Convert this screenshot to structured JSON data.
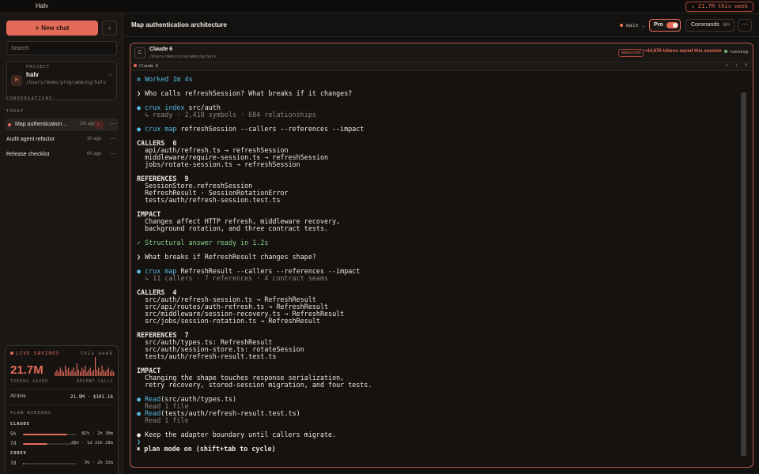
{
  "titlebar": {
    "app_name": "Halv",
    "week_pill": "↓ 21.7M this week"
  },
  "sidebar": {
    "new_chat_label": "New chat",
    "collapse_icon": "‹",
    "search_placeholder": "Search",
    "project": {
      "label": "PROJECT",
      "avatar": "H",
      "name": "halv",
      "path": "/Users/demo/programming/halv"
    },
    "conversations_label": "CONVERSATIONS",
    "today_label": "TODAY",
    "conversations": [
      {
        "title": "Map authentication…",
        "time": "2m ago"
      },
      {
        "title": "Audit agent refactor",
        "time": "2h ago"
      },
      {
        "title": "Release checklist",
        "time": "6h ago"
      }
    ],
    "savings": {
      "live_label": "LIVE SAVINGS",
      "week_label": "this week",
      "tokens_saved": "21.7M",
      "tokens_saved_label": "TOKENS SAVED",
      "recent_calls_label": "RECENT CALLS",
      "recent_calls": [
        2,
        3,
        2,
        4,
        3,
        2,
        5,
        3,
        4,
        2,
        3,
        4,
        2,
        6,
        3,
        2,
        4,
        3,
        5,
        2,
        3,
        4,
        2,
        3,
        9,
        3,
        4,
        2,
        5,
        3,
        2,
        3,
        4,
        2,
        3,
        2
      ],
      "all_time_label": "All time",
      "all_time_value": "21.9M · $101.16",
      "plan_windows_label": "PLAN WINDOWS",
      "groups": [
        {
          "name": "CLAUDE",
          "rows": [
            {
              "label": "5h",
              "fraction": 0.82,
              "value": "82% · 2h 38m"
            },
            {
              "label": "7d",
              "fraction": 0.45,
              "value": "45% · 1d 21h 28m"
            }
          ]
        },
        {
          "name": "CODEX",
          "rows": [
            {
              "label": "7d",
              "fraction": 0.03,
              "value": "3% · 2h 32m"
            }
          ]
        }
      ]
    }
  },
  "main": {
    "title": "Map authentication architecture",
    "branch": "main",
    "pro_label": "Pro",
    "pro_enabled": true,
    "commands_label": "Commands",
    "commands_kbd": "⌘K",
    "more_icon": "···"
  },
  "session": {
    "avatar": "C",
    "name": "Claude 6",
    "path": "/Users/demo/programming/halv",
    "measured_label": "measured",
    "tokens_saved": "≈44,876 tokens saved this session",
    "status": "running",
    "tab_label": "Claude 6",
    "window_controls": [
      "⌐",
      "↓",
      "×"
    ]
  },
  "terminal": {
    "lines": [
      {
        "kind": "accent",
        "text": "✻ Worked 1m 4s"
      },
      {
        "kind": "blank",
        "text": ""
      },
      {
        "kind": "prompt",
        "text": "❯ Who calls refreshSession? What breaks if it changes?"
      },
      {
        "kind": "blank",
        "text": ""
      },
      {
        "kind": "tool",
        "cmd": "crux index",
        "arg": " src/auth"
      },
      {
        "kind": "dim",
        "text": "  ↳ ready · 2,418 symbols · 684 relationships"
      },
      {
        "kind": "blank",
        "text": ""
      },
      {
        "kind": "tool",
        "cmd": "crux map",
        "arg": " refreshSession --callers --references --impact"
      },
      {
        "kind": "blank",
        "text": ""
      },
      {
        "kind": "heading",
        "text": "CALLERS  6"
      },
      {
        "kind": "text",
        "text": "  api/auth/refresh.ts → refreshSession"
      },
      {
        "kind": "text",
        "text": "  middleware/require-session.ts → refreshSession"
      },
      {
        "kind": "text",
        "text": "  jobs/rotate-session.ts → refreshSession"
      },
      {
        "kind": "blank",
        "text": ""
      },
      {
        "kind": "heading",
        "text": "REFERENCES  9"
      },
      {
        "kind": "text",
        "text": "  SessionStore.refreshSession"
      },
      {
        "kind": "text",
        "text": "  RefreshResult · SessionRotationError"
      },
      {
        "kind": "text",
        "text": "  tests/auth/refresh-session.test.ts"
      },
      {
        "kind": "blank",
        "text": ""
      },
      {
        "kind": "heading",
        "text": "IMPACT"
      },
      {
        "kind": "text",
        "text": "  Changes affect HTTP refresh, middleware recovery,"
      },
      {
        "kind": "text",
        "text": "  background rotation, and three contract tests."
      },
      {
        "kind": "blank",
        "text": ""
      },
      {
        "kind": "success",
        "text": "✓ Structural answer ready in 1.2s"
      },
      {
        "kind": "blank",
        "text": ""
      },
      {
        "kind": "prompt",
        "text": "❯ What breaks if RefreshResult changes shape?"
      },
      {
        "kind": "blank",
        "text": ""
      },
      {
        "kind": "tool",
        "cmd": "crux map",
        "arg": " RefreshResult --callers --references --impact"
      },
      {
        "kind": "dim",
        "text": "  ↳ 11 callers · 7 references · 4 contract seams"
      },
      {
        "kind": "blank",
        "text": ""
      },
      {
        "kind": "heading",
        "text": "CALLERS  4"
      },
      {
        "kind": "text",
        "text": "  src/auth/refresh-session.ts → RefreshResult"
      },
      {
        "kind": "text",
        "text": "  src/api/routes/auth-refresh.ts → RefreshResult"
      },
      {
        "kind": "text",
        "text": "  src/middleware/session-recovery.ts → RefreshResult"
      },
      {
        "kind": "text",
        "text": "  src/jobs/session-rotation.ts → RefreshResult"
      },
      {
        "kind": "blank",
        "text": ""
      },
      {
        "kind": "heading",
        "text": "REFERENCES  7"
      },
      {
        "kind": "text",
        "text": "  src/auth/types.ts: RefreshResult"
      },
      {
        "kind": "text",
        "text": "  src/auth/session-store.ts: rotateSession"
      },
      {
        "kind": "text",
        "text": "  tests/auth/refresh-result.test.ts"
      },
      {
        "kind": "blank",
        "text": ""
      },
      {
        "kind": "heading",
        "text": "IMPACT"
      },
      {
        "kind": "text",
        "text": "  Changing the shape touches response serialization,"
      },
      {
        "kind": "text",
        "text": "  retry recovery, stored-session migration, and four tests."
      },
      {
        "kind": "blank",
        "text": ""
      },
      {
        "kind": "read",
        "cmd": "Read",
        "arg": "(src/auth/types.ts)"
      },
      {
        "kind": "dim",
        "text": "  Read 1 file"
      },
      {
        "kind": "read",
        "cmd": "Read",
        "arg": "(tests/auth/refresh-result.test.ts)"
      },
      {
        "kind": "dim",
        "text": "  Read 1 file"
      },
      {
        "kind": "blank",
        "text": ""
      },
      {
        "kind": "note",
        "text": "● Keep the adapter boundary until callers migrate."
      },
      {
        "kind": "cursor",
        "text": "❯"
      },
      {
        "kind": "mode",
        "text": "⏸ plan mode on (shift+tab to cycle)"
      }
    ]
  },
  "colors": {
    "accent": "#e46b58",
    "info": "#58b8e0",
    "success": "#86d08a",
    "running": "#6cc070"
  }
}
